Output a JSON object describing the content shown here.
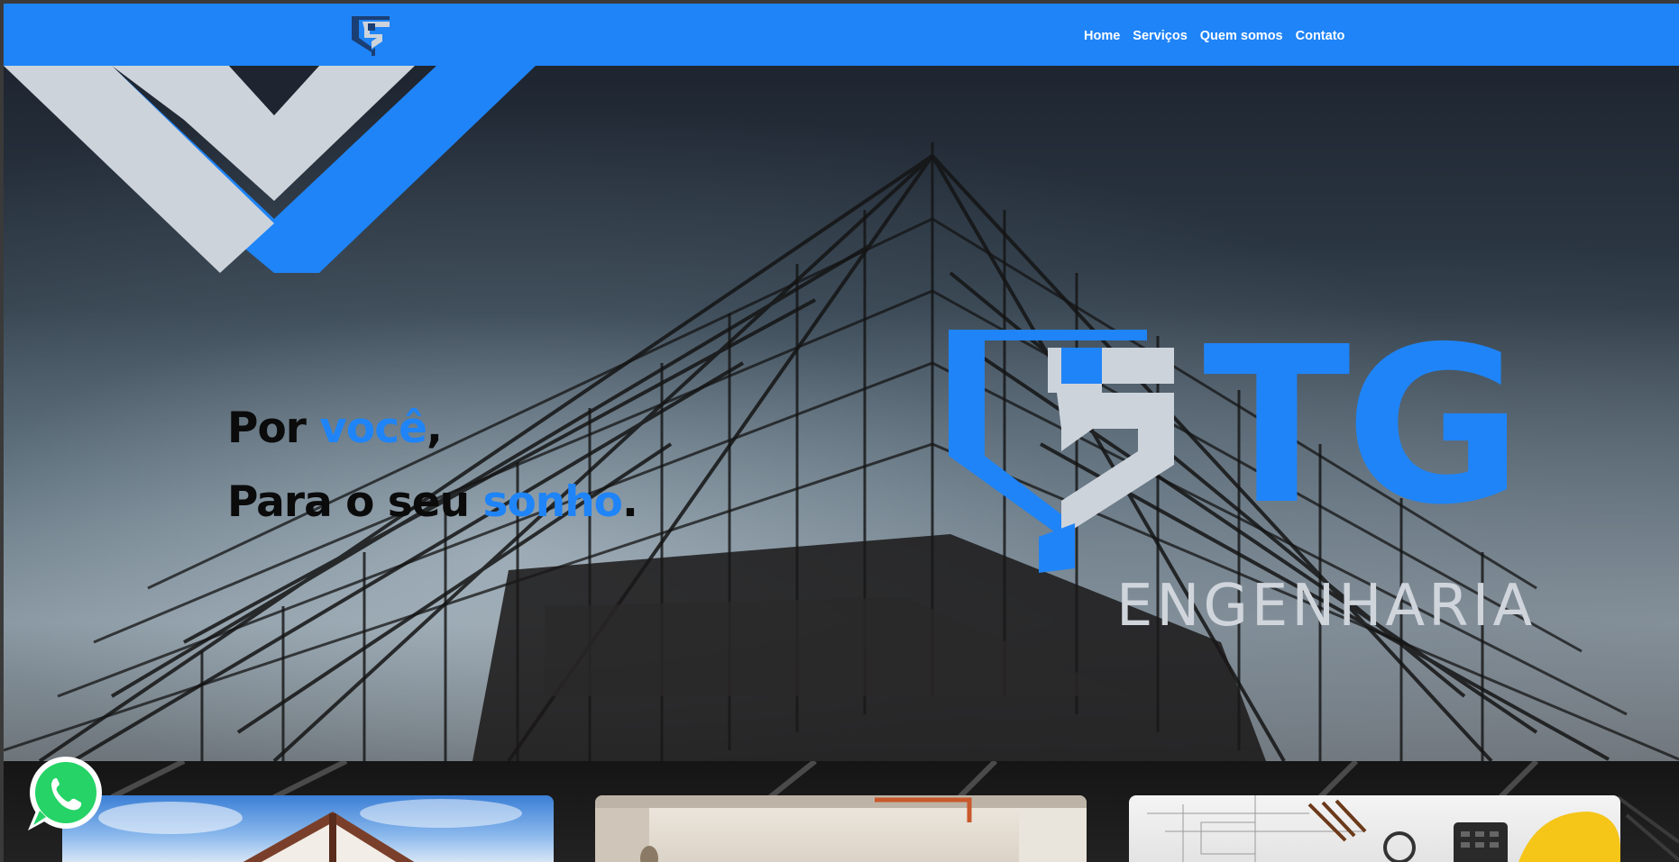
{
  "nav": {
    "items": [
      {
        "label": "Home"
      },
      {
        "label": "Serviços"
      },
      {
        "label": "Quem somos"
      },
      {
        "label": "Contato"
      }
    ]
  },
  "hero": {
    "line1": {
      "before": "Por ",
      "accent": "você",
      "after": ","
    },
    "line2": {
      "before": "Para o seu ",
      "accent": "sonho",
      "after": "."
    }
  },
  "brand": {
    "logo_text": "TG",
    "logo_subtitle": "ENGENHARIA"
  },
  "colors": {
    "accent": "#1f84f7",
    "light_gray": "#d0d5dc",
    "text_dark": "#0b0b0b"
  },
  "icons": {
    "whatsapp": "whatsapp-icon",
    "logo": "tg-logo-icon"
  }
}
